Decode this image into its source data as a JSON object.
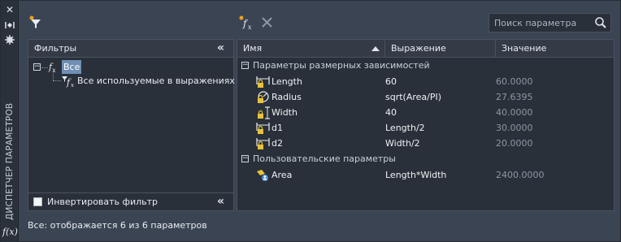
{
  "window": {
    "title_vertical": "ДИСПЕТЧЕР ПАРАМЕТРОВ",
    "strip_buttons": [
      "close-icon",
      "pin-icon",
      "properties-icon"
    ],
    "fx_label": "f(x)"
  },
  "toolbar": {
    "icons": [
      "new-filter-icon",
      "new-user-parameter-icon",
      "delete-parameter-icon"
    ],
    "search_placeholder": "Поиск параметра"
  },
  "filters": {
    "title": "Фильтры",
    "tree": [
      {
        "label": "Все",
        "selected": true,
        "expanded": true
      },
      {
        "label": "Все используемые в выражениях",
        "selected": false
      }
    ],
    "invert_label": "Инвертировать фильтр",
    "invert_checked": false
  },
  "grid": {
    "columns": [
      "Имя",
      "Выражение",
      "Значение"
    ],
    "sort_column": "Имя",
    "groups": [
      {
        "label": "Параметры размерных зависимостей",
        "expanded": true,
        "rows": [
          {
            "icon": "linear-constraint-lock-icon",
            "name": "Length",
            "expression": "60",
            "value": "60.0000"
          },
          {
            "icon": "radial-constraint-lock-icon",
            "name": "Radius",
            "expression": "sqrt(Area/PI)",
            "value": "27.6395"
          },
          {
            "icon": "vertical-constraint-lock-icon",
            "name": "Width",
            "expression": "40",
            "value": "40.0000"
          },
          {
            "icon": "linear-constraint-lock-icon",
            "name": "d1",
            "expression": "Length/2",
            "value": "30.0000"
          },
          {
            "icon": "linear-constraint-lock-icon",
            "name": "d2",
            "expression": "Width/2",
            "value": "20.0000"
          }
        ]
      },
      {
        "label": "Пользовательские параметры",
        "expanded": true,
        "rows": [
          {
            "icon": "user-parameter-icon",
            "name": "Area",
            "expression": "Length*Width",
            "value": "2400.0000"
          }
        ]
      }
    ]
  },
  "status": "Все: отображается 6 из 6 параметров",
  "colors": {
    "background": "#3b4453",
    "panel": "#2a3039",
    "selection": "#6f8fb3",
    "lock_yellow": "#e8c23a",
    "value_dim": "#8d96a3"
  }
}
